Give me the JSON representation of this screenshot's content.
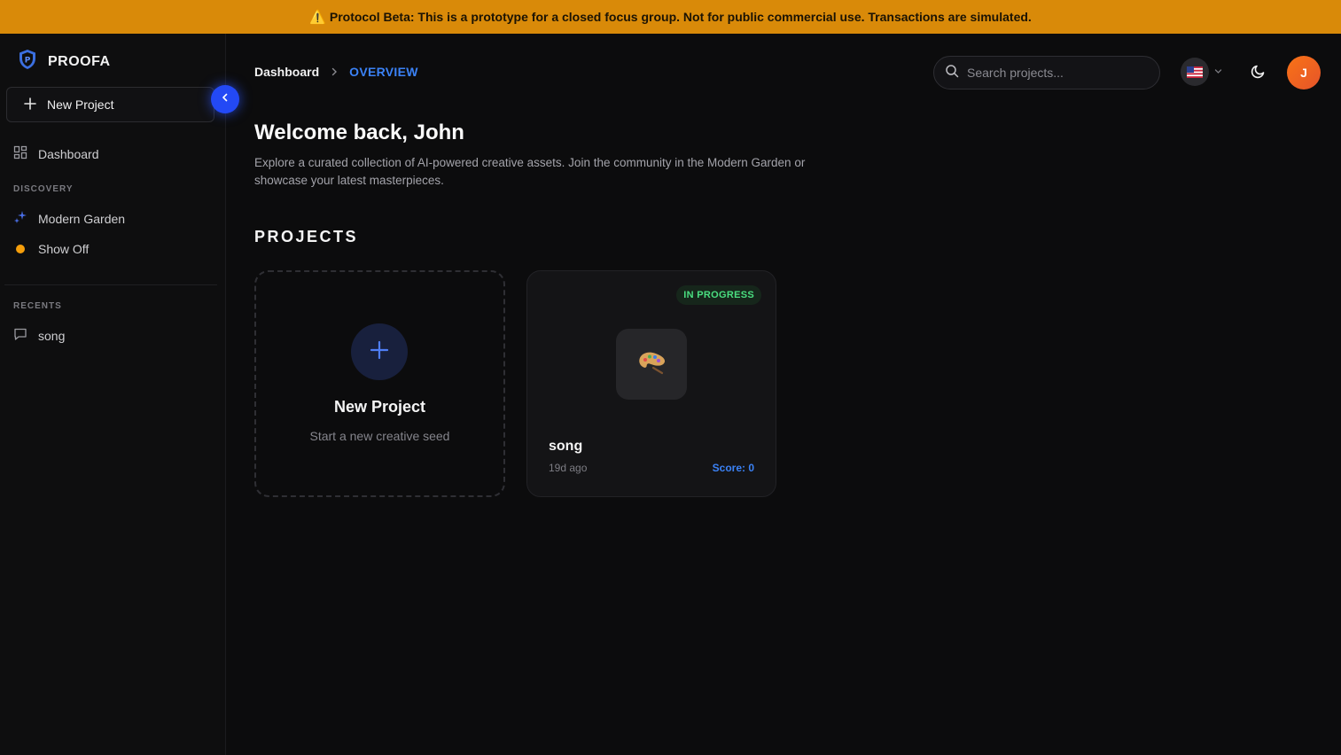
{
  "banner": {
    "icon": "warning-icon",
    "text": "Protocol Beta: This is a prototype for a closed focus group. Not for public commercial use. Transactions are simulated."
  },
  "sidebar": {
    "brand": "PROOFA",
    "new_project_label": "New Project",
    "dashboard_label": "Dashboard",
    "discovery_label": "DISCOVERY",
    "discovery_items": [
      {
        "label": "Modern Garden",
        "icon": "sparkles-icon"
      },
      {
        "label": "Show Off",
        "icon": "orange-dot-icon"
      }
    ],
    "recents_label": "RECENTS",
    "recents": [
      {
        "label": "song",
        "icon": "chat-icon"
      }
    ]
  },
  "header": {
    "breadcrumb": [
      "Dashboard",
      "OVERVIEW"
    ],
    "search_placeholder": "Search projects...",
    "avatar_initial": "J"
  },
  "main": {
    "welcome": "Welcome back, John",
    "intro": "Explore a curated collection of AI-powered creative assets. Join the community in the Modern Garden or showcase your latest masterpieces.",
    "projects_title": "PROJECTS",
    "new_card": {
      "title": "New Project",
      "subtitle": "Start a new creative seed"
    },
    "projects": [
      {
        "status": "IN PROGRESS",
        "thumb_icon": "palette-icon",
        "name": "song",
        "time": "19d ago",
        "score": "Score: 0"
      }
    ]
  },
  "colors": {
    "accent": "#3b82f6",
    "banner": "#d98a09",
    "status_green": "#4ade80",
    "avatar": "#f97316"
  }
}
